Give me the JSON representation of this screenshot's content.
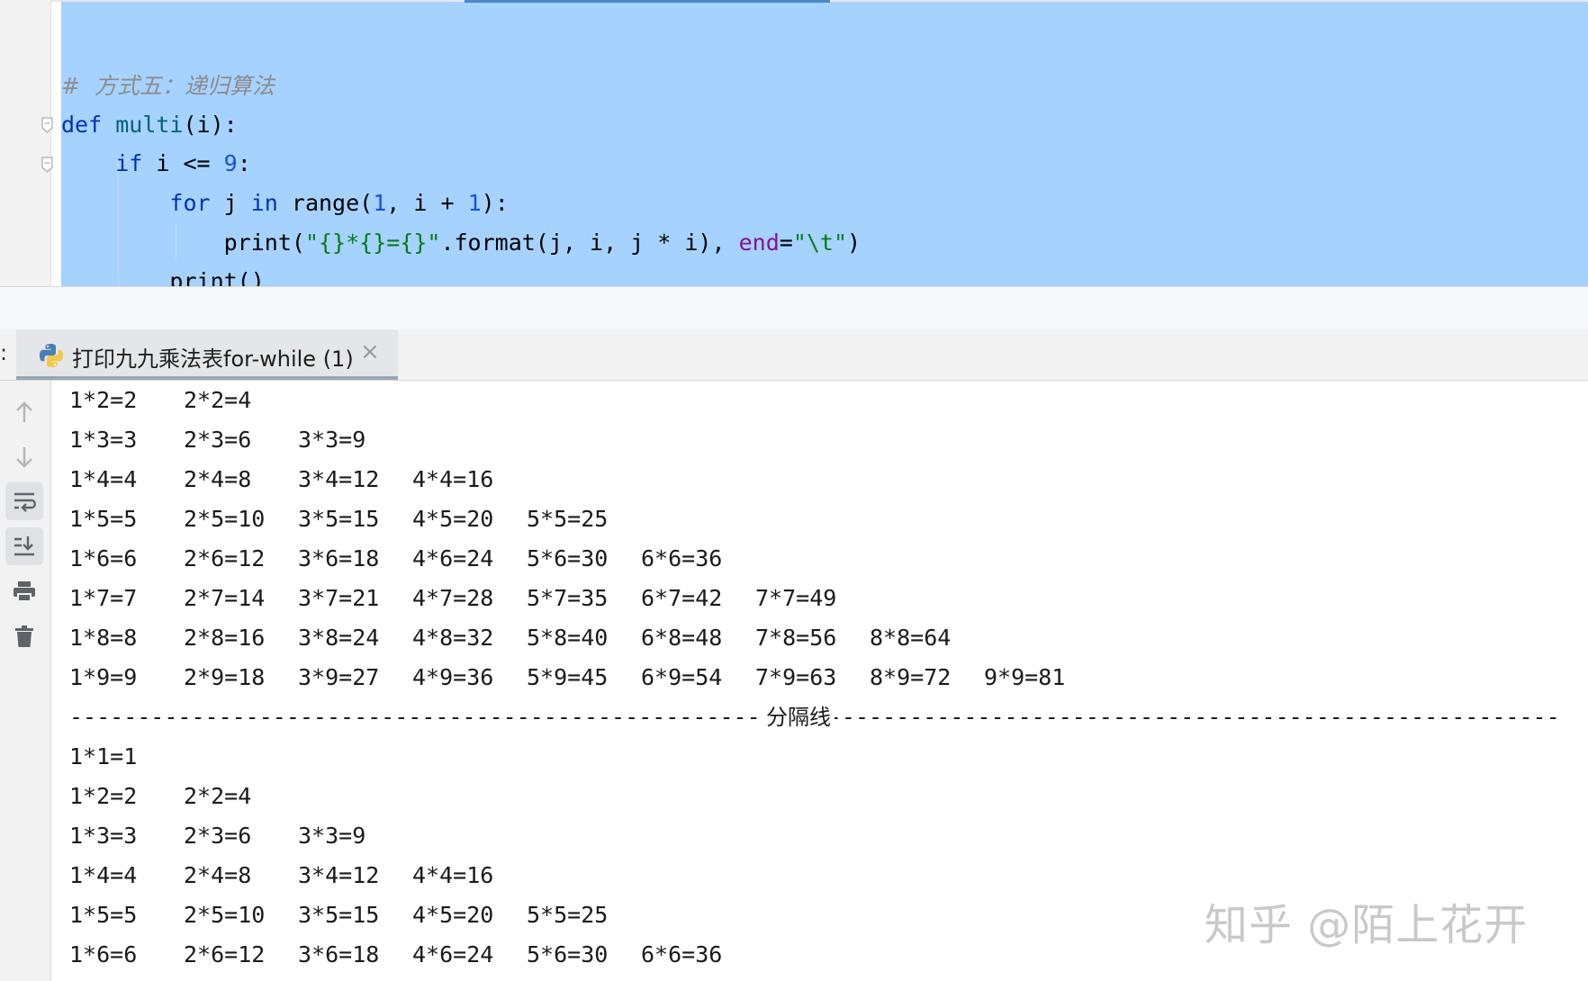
{
  "editor": {
    "lines": [
      {
        "tokens": [
          {
            "c": "comment",
            "t": "#  方式五：递归算法"
          }
        ]
      },
      {
        "tokens": [
          {
            "c": "kw",
            "t": "def "
          },
          {
            "c": "fn",
            "t": "multi"
          },
          {
            "c": "call",
            "t": "(i):"
          }
        ]
      },
      {
        "tokens": [
          {
            "c": "call",
            "t": "    "
          },
          {
            "c": "kw",
            "t": "if"
          },
          {
            "c": "call",
            "t": " i <= "
          },
          {
            "c": "num",
            "t": "9"
          },
          {
            "c": "call",
            "t": ":"
          }
        ]
      },
      {
        "tokens": [
          {
            "c": "call",
            "t": "        "
          },
          {
            "c": "kw",
            "t": "for"
          },
          {
            "c": "call",
            "t": " j "
          },
          {
            "c": "kw",
            "t": "in"
          },
          {
            "c": "call",
            "t": " range("
          },
          {
            "c": "num",
            "t": "1"
          },
          {
            "c": "call",
            "t": ", i + "
          },
          {
            "c": "num",
            "t": "1"
          },
          {
            "c": "call",
            "t": "):"
          }
        ]
      },
      {
        "tokens": [
          {
            "c": "call",
            "t": "            print("
          },
          {
            "c": "str",
            "t": "\"{}*{}={}\""
          },
          {
            "c": "call",
            "t": ".format(j, i, j * i), "
          },
          {
            "c": "param",
            "t": "end"
          },
          {
            "c": "call",
            "t": "="
          },
          {
            "c": "str",
            "t": "\"\\t\""
          },
          {
            "c": "call",
            "t": ")"
          }
        ]
      },
      {
        "tokens": [
          {
            "c": "call",
            "t": "        print()"
          }
        ]
      }
    ]
  },
  "run_tab": {
    "prefix": ":",
    "label": "打印九九乘法表for-while (1)",
    "close": "×"
  },
  "toolbar": {
    "icons": [
      "up-arrow-icon",
      "down-arrow-icon",
      "soft-wrap-icon",
      "scroll-to-end-icon",
      "print-icon",
      "trash-icon"
    ]
  },
  "console": {
    "rows_before": [
      [
        "1*2=2",
        "2*2=4"
      ],
      [
        "1*3=3",
        "2*3=6",
        "3*3=9"
      ],
      [
        "1*4=4",
        "2*4=8",
        "3*4=12",
        "4*4=16"
      ],
      [
        "1*5=5",
        "2*5=10",
        "3*5=15",
        "4*5=20",
        "5*5=25"
      ],
      [
        "1*6=6",
        "2*6=12",
        "3*6=18",
        "4*6=24",
        "5*6=30",
        "6*6=36"
      ],
      [
        "1*7=7",
        "2*7=14",
        "3*7=21",
        "4*7=28",
        "5*7=35",
        "6*7=42",
        "7*7=49"
      ],
      [
        "1*8=8",
        "2*8=16",
        "3*8=24",
        "4*8=32",
        "5*8=40",
        "6*8=48",
        "7*8=56",
        "8*8=64"
      ],
      [
        "1*9=9",
        "2*9=18",
        "3*9=27",
        "4*9=36",
        "5*9=45",
        "6*9=54",
        "7*9=63",
        "8*9=72",
        "9*9=81"
      ]
    ],
    "separator_label": "分隔线",
    "rows_after": [
      [
        "1*1=1"
      ],
      [
        "1*2=2",
        "2*2=4"
      ],
      [
        "1*3=3",
        "2*3=6",
        "3*3=9"
      ],
      [
        "1*4=4",
        "2*4=8",
        "3*4=12",
        "4*4=16"
      ],
      [
        "1*5=5",
        "2*5=10",
        "3*5=15",
        "4*5=20",
        "5*5=25"
      ],
      [
        "1*6=6",
        "2*6=12",
        "3*6=18",
        "4*6=24",
        "5*6=30",
        "6*6=36"
      ]
    ]
  },
  "watermark": "知乎 @陌上花开",
  "colors": {
    "selection": "#a6d2ff",
    "keyword": "#0033b3",
    "function": "#00627a",
    "number": "#1750eb",
    "string": "#067d17",
    "param": "#871094",
    "comment": "#8c8c8c"
  }
}
